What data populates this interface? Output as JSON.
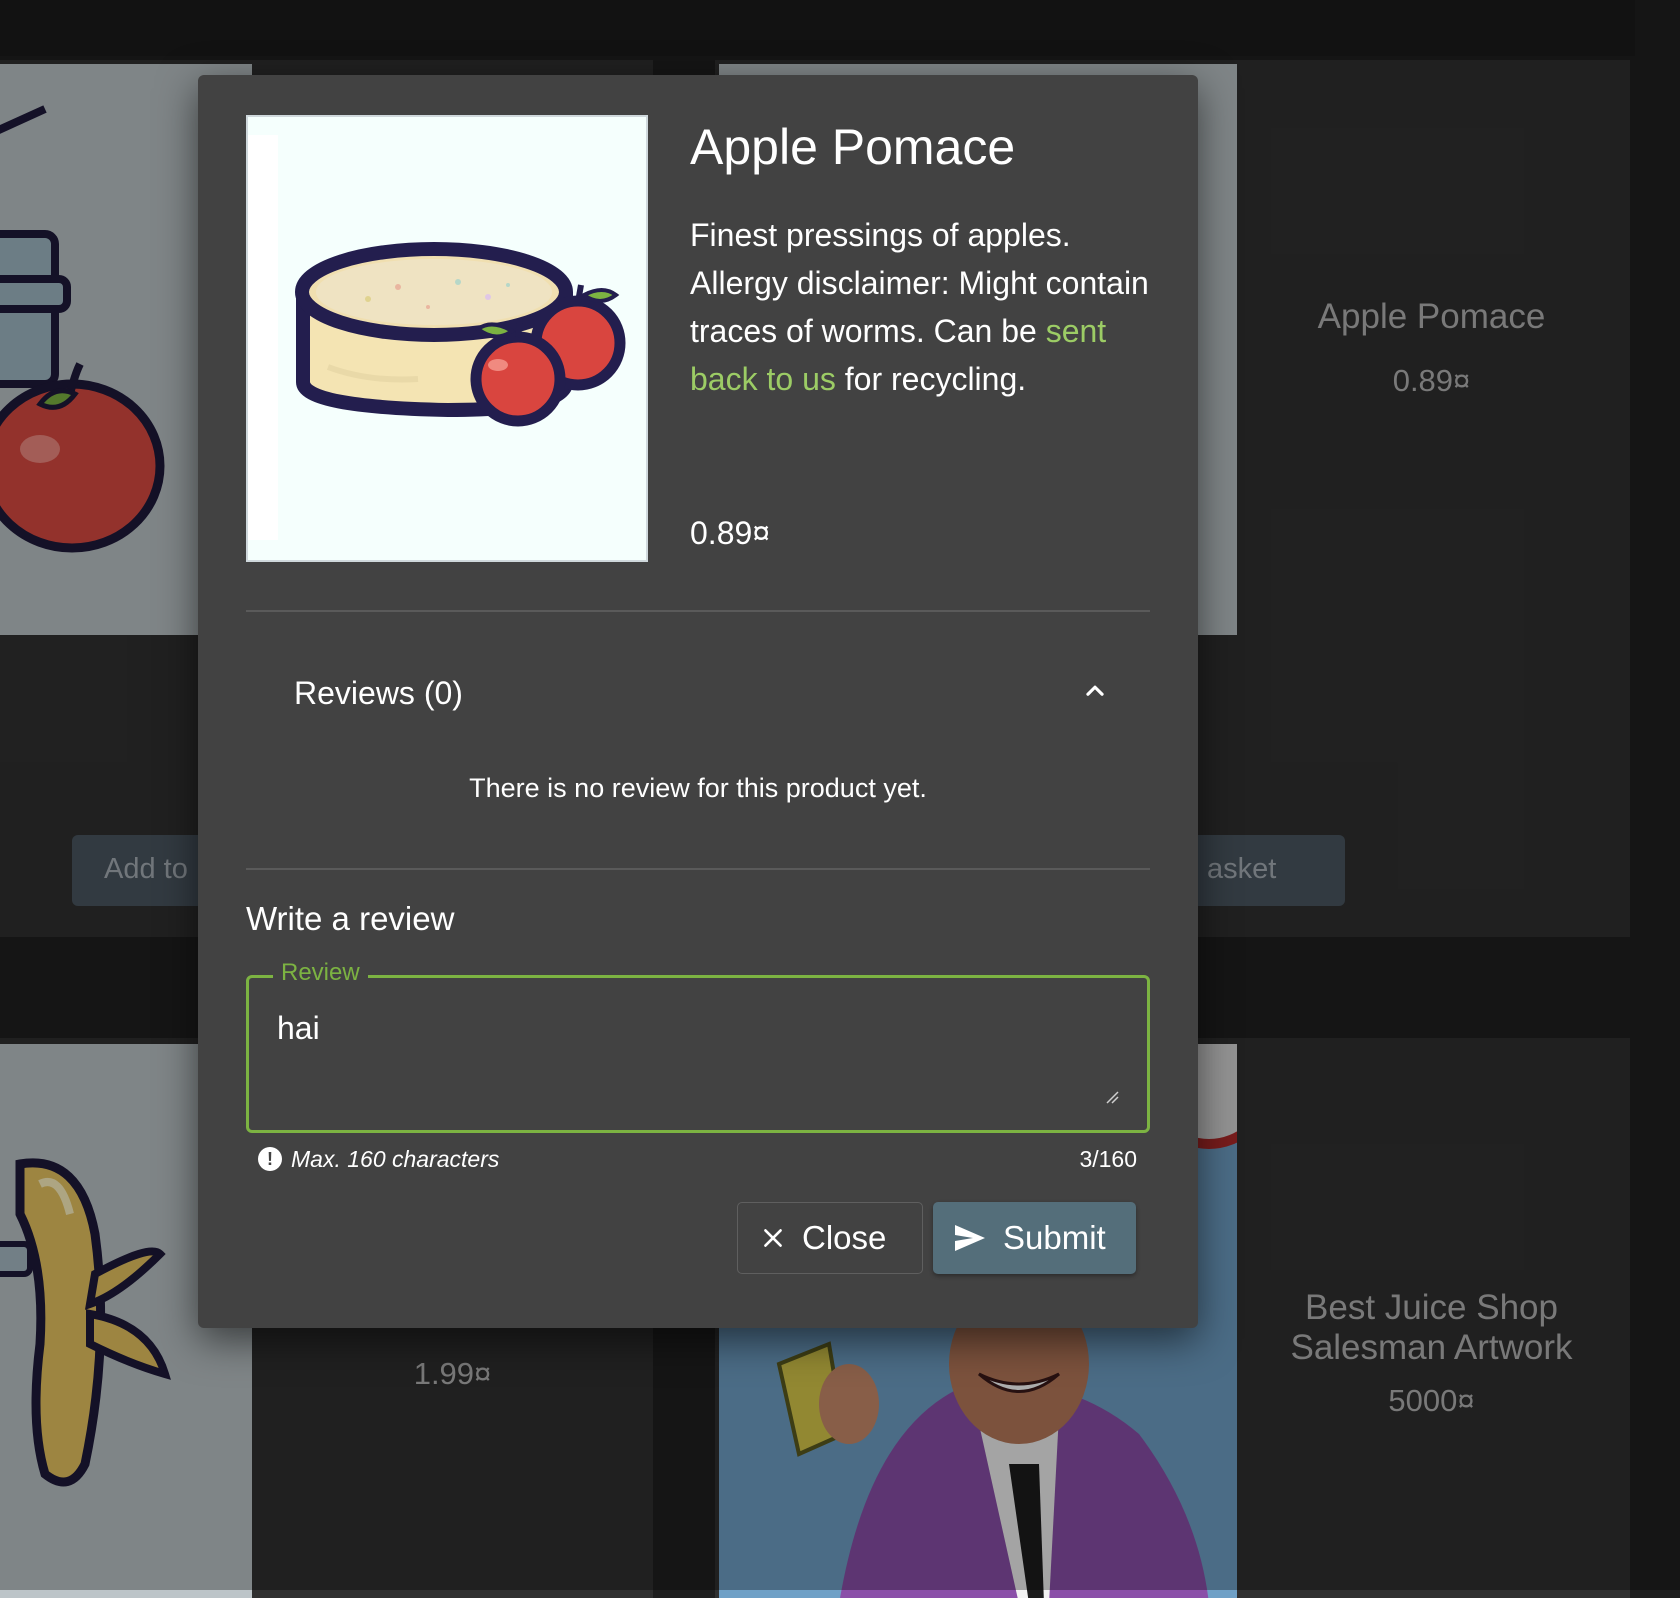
{
  "background": {
    "cards": [
      {
        "name": "Apple Pomace",
        "price": "0.89¤"
      },
      {
        "price": "1.99¤"
      },
      {
        "name": "Best Juice Shop Salesman Artwork",
        "price": "5000¤"
      }
    ],
    "buttons": {
      "left_add": "Add to B",
      "right_add": "asket"
    }
  },
  "dialog": {
    "product": {
      "title": "Apple Pomace",
      "desc_before": "Finest pressings of apples. Allergy disclaimer: Might contain traces of worms. Can be ",
      "desc_link": "sent back to us",
      "desc_after": " for recycling.",
      "price": "0.89¤"
    },
    "reviews": {
      "header": "Reviews (0)",
      "empty": "There is no review for this product yet."
    },
    "write": {
      "title": "Write a review",
      "label": "Review",
      "value": "hai",
      "hint": "Max. 160 characters",
      "counter": "3/160"
    },
    "actions": {
      "close": "Close",
      "submit": "Submit"
    }
  },
  "colors": {
    "accent_green": "#7cb342",
    "link_green": "#9ccc65",
    "submit_bg": "#546e7a",
    "dialog_bg": "#424242"
  },
  "icons": [
    "chevron-up-icon",
    "close-icon",
    "send-icon",
    "exclamation-circle-icon",
    "resize-handle-icon"
  ]
}
